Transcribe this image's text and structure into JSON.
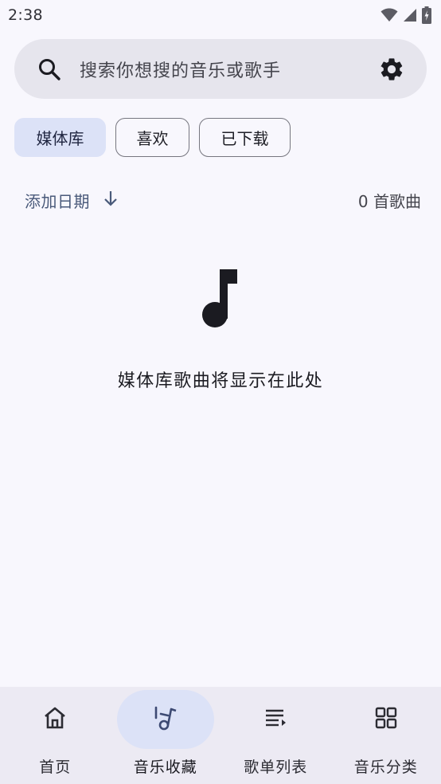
{
  "status_bar": {
    "time": "2:38",
    "icons": [
      "wifi-icon",
      "signal-icon",
      "battery-charging-icon"
    ]
  },
  "search": {
    "placeholder": "搜索你想搜的音乐或歌手",
    "icon": "search-icon",
    "settings_icon": "gear-icon"
  },
  "chips": [
    {
      "label": "媒体库",
      "selected": true
    },
    {
      "label": "喜欢",
      "selected": false
    },
    {
      "label": "已下载",
      "selected": false
    }
  ],
  "sort": {
    "label": "添加日期",
    "direction_icon": "arrow-down-icon",
    "count_label": "0 首歌曲"
  },
  "empty_state": {
    "icon": "music-note-icon",
    "message": "媒体库歌曲将显示在此处"
  },
  "bottom_nav": {
    "active_index": 1,
    "items": [
      {
        "label": "首页",
        "icon": "home-icon"
      },
      {
        "label": "音乐收藏",
        "icon": "music-library-icon"
      },
      {
        "label": "歌单列表",
        "icon": "playlist-icon"
      },
      {
        "label": "音乐分类",
        "icon": "grid-icon"
      }
    ]
  },
  "colors": {
    "background": "#f8f7fd",
    "search_bg": "#e6e5ed",
    "chip_selected_bg": "#dce2f7",
    "accent_text": "#4a5a7a",
    "nav_bg": "#eceaf3"
  }
}
